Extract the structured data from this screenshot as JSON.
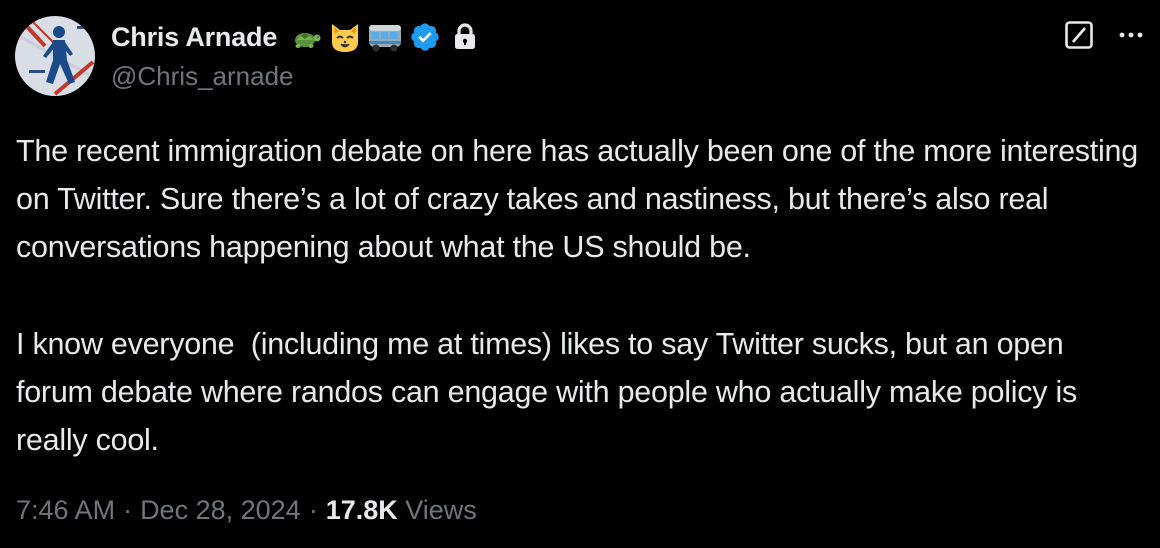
{
  "author": {
    "display_name": "Chris Arnade",
    "handle": "@Chris_arnade",
    "name_emojis": [
      "turtle-emoji",
      "cat-emoji",
      "bus-emoji"
    ],
    "verified": true,
    "protected": true
  },
  "tweet": {
    "paragraphs": [
      "The recent immigration debate on here has actually been one of the more interesting on Twitter. Sure there’s a lot of crazy takes and nastiness, but there’s also real conversations happening about what the US should be.",
      "I know everyone  (including me at times) likes to say Twitter sucks, but an open forum debate where randos can engage with people who actually make policy is really cool."
    ]
  },
  "meta": {
    "time": "7:46 AM",
    "separator": "·",
    "date": "Dec 28, 2024",
    "views_count": "17.8K",
    "views_label": "Views"
  },
  "colors": {
    "background": "#000000",
    "text_primary": "#e7e9ea",
    "text_secondary": "#71767b",
    "verified_badge": "#1d9bf0"
  }
}
